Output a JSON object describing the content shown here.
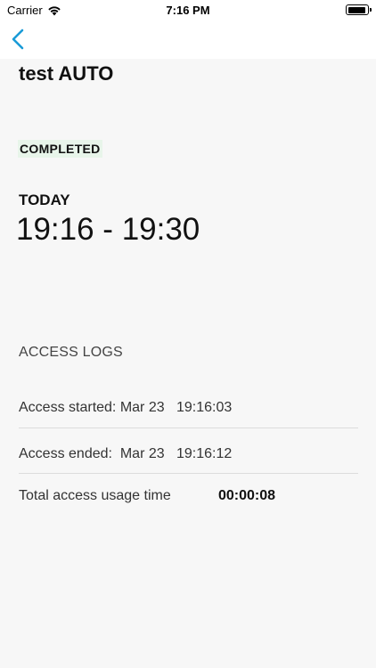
{
  "status_bar": {
    "carrier": "Carrier",
    "time": "7:16 PM"
  },
  "nav": {
    "back_icon": "chevron-left-icon",
    "accent": "#1a9bd7"
  },
  "booking": {
    "title": "test AUTO",
    "status": "COMPLETED",
    "status_color": "#e8f5ea",
    "day": "TODAY",
    "time_range": "19:16 - 19:30"
  },
  "access_logs": {
    "heading": "ACCESS LOGS",
    "started": "Access started: Mar 23   19:16:03",
    "ended": "Access ended:  Mar 23   19:16:12",
    "total_label": "Total access usage time",
    "total_value": "00:00:08"
  }
}
